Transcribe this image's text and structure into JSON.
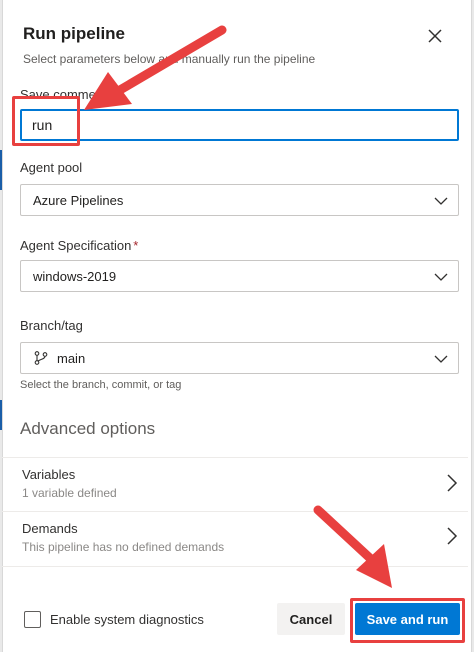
{
  "dialog": {
    "title": "Run pipeline",
    "subtitle": "Select parameters below and manually run the pipeline",
    "close_icon": "close-icon"
  },
  "fields": {
    "save_comment": {
      "label": "Save comment",
      "value": "run"
    },
    "agent_pool": {
      "label": "Agent pool",
      "value": "Azure Pipelines"
    },
    "agent_spec": {
      "label": "Agent Specification",
      "required_mark": "*",
      "value": "windows-2019"
    },
    "branch": {
      "label": "Branch/tag",
      "value": "main",
      "icon": "branch-icon",
      "helper": "Select the branch, commit, or tag"
    }
  },
  "advanced": {
    "heading": "Advanced options",
    "variables": {
      "title": "Variables",
      "subtitle": "1 variable defined"
    },
    "demands": {
      "title": "Demands",
      "subtitle": "This pipeline has no defined demands"
    }
  },
  "footer": {
    "diagnostics_label": "Enable system diagnostics",
    "diagnostics_checked": false,
    "cancel_label": "Cancel",
    "primary_label": "Save and run"
  },
  "colors": {
    "primary": "#0078d4",
    "annotation": "#e8403f",
    "required": "#a4262c"
  }
}
